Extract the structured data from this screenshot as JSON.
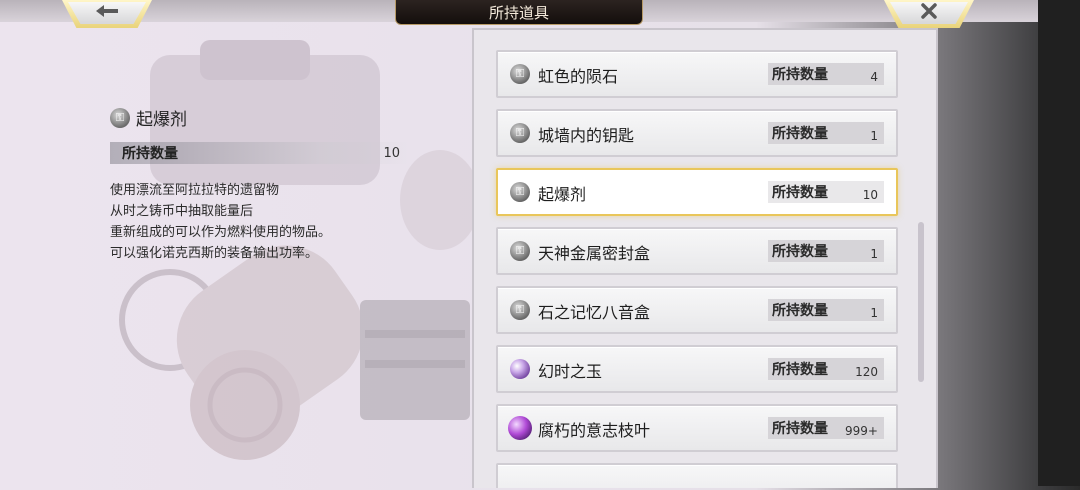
{
  "header": {
    "title": "所持道具"
  },
  "nav": {
    "back_icon": "arrow-left-icon",
    "close_icon": "close-icon"
  },
  "detail": {
    "name": "起爆剂",
    "qty_label": "所持数量",
    "qty_value": "10",
    "description": "使用漂流至阿拉拉特的遗留物\n从时之铸币中抽取能量后\n重新组成的可以作为燃料使用的物品。\n可以强化诺克西斯的装备输出功率。"
  },
  "items": [
    {
      "name": "虹色的陨石",
      "qty_label": "所持数量",
      "qty": "4",
      "icon": "key-icon"
    },
    {
      "name": "城墙内的钥匙",
      "qty_label": "所持数量",
      "qty": "1",
      "icon": "key-icon"
    },
    {
      "name": "起爆剂",
      "qty_label": "所持数量",
      "qty": "10",
      "icon": "key-icon"
    },
    {
      "name": "天神金属密封盒",
      "qty_label": "所持数量",
      "qty": "1",
      "icon": "key-icon"
    },
    {
      "name": "石之记忆八音盒",
      "qty_label": "所持数量",
      "qty": "1",
      "icon": "key-icon"
    },
    {
      "name": "幻时之玉",
      "qty_label": "所持数量",
      "qty": "120",
      "icon": "orb-icon"
    },
    {
      "name": "腐朽的意志枝叶",
      "qty_label": "所持数量",
      "qty": "999+",
      "icon": "leaf-icon"
    }
  ],
  "selected_index": 2
}
